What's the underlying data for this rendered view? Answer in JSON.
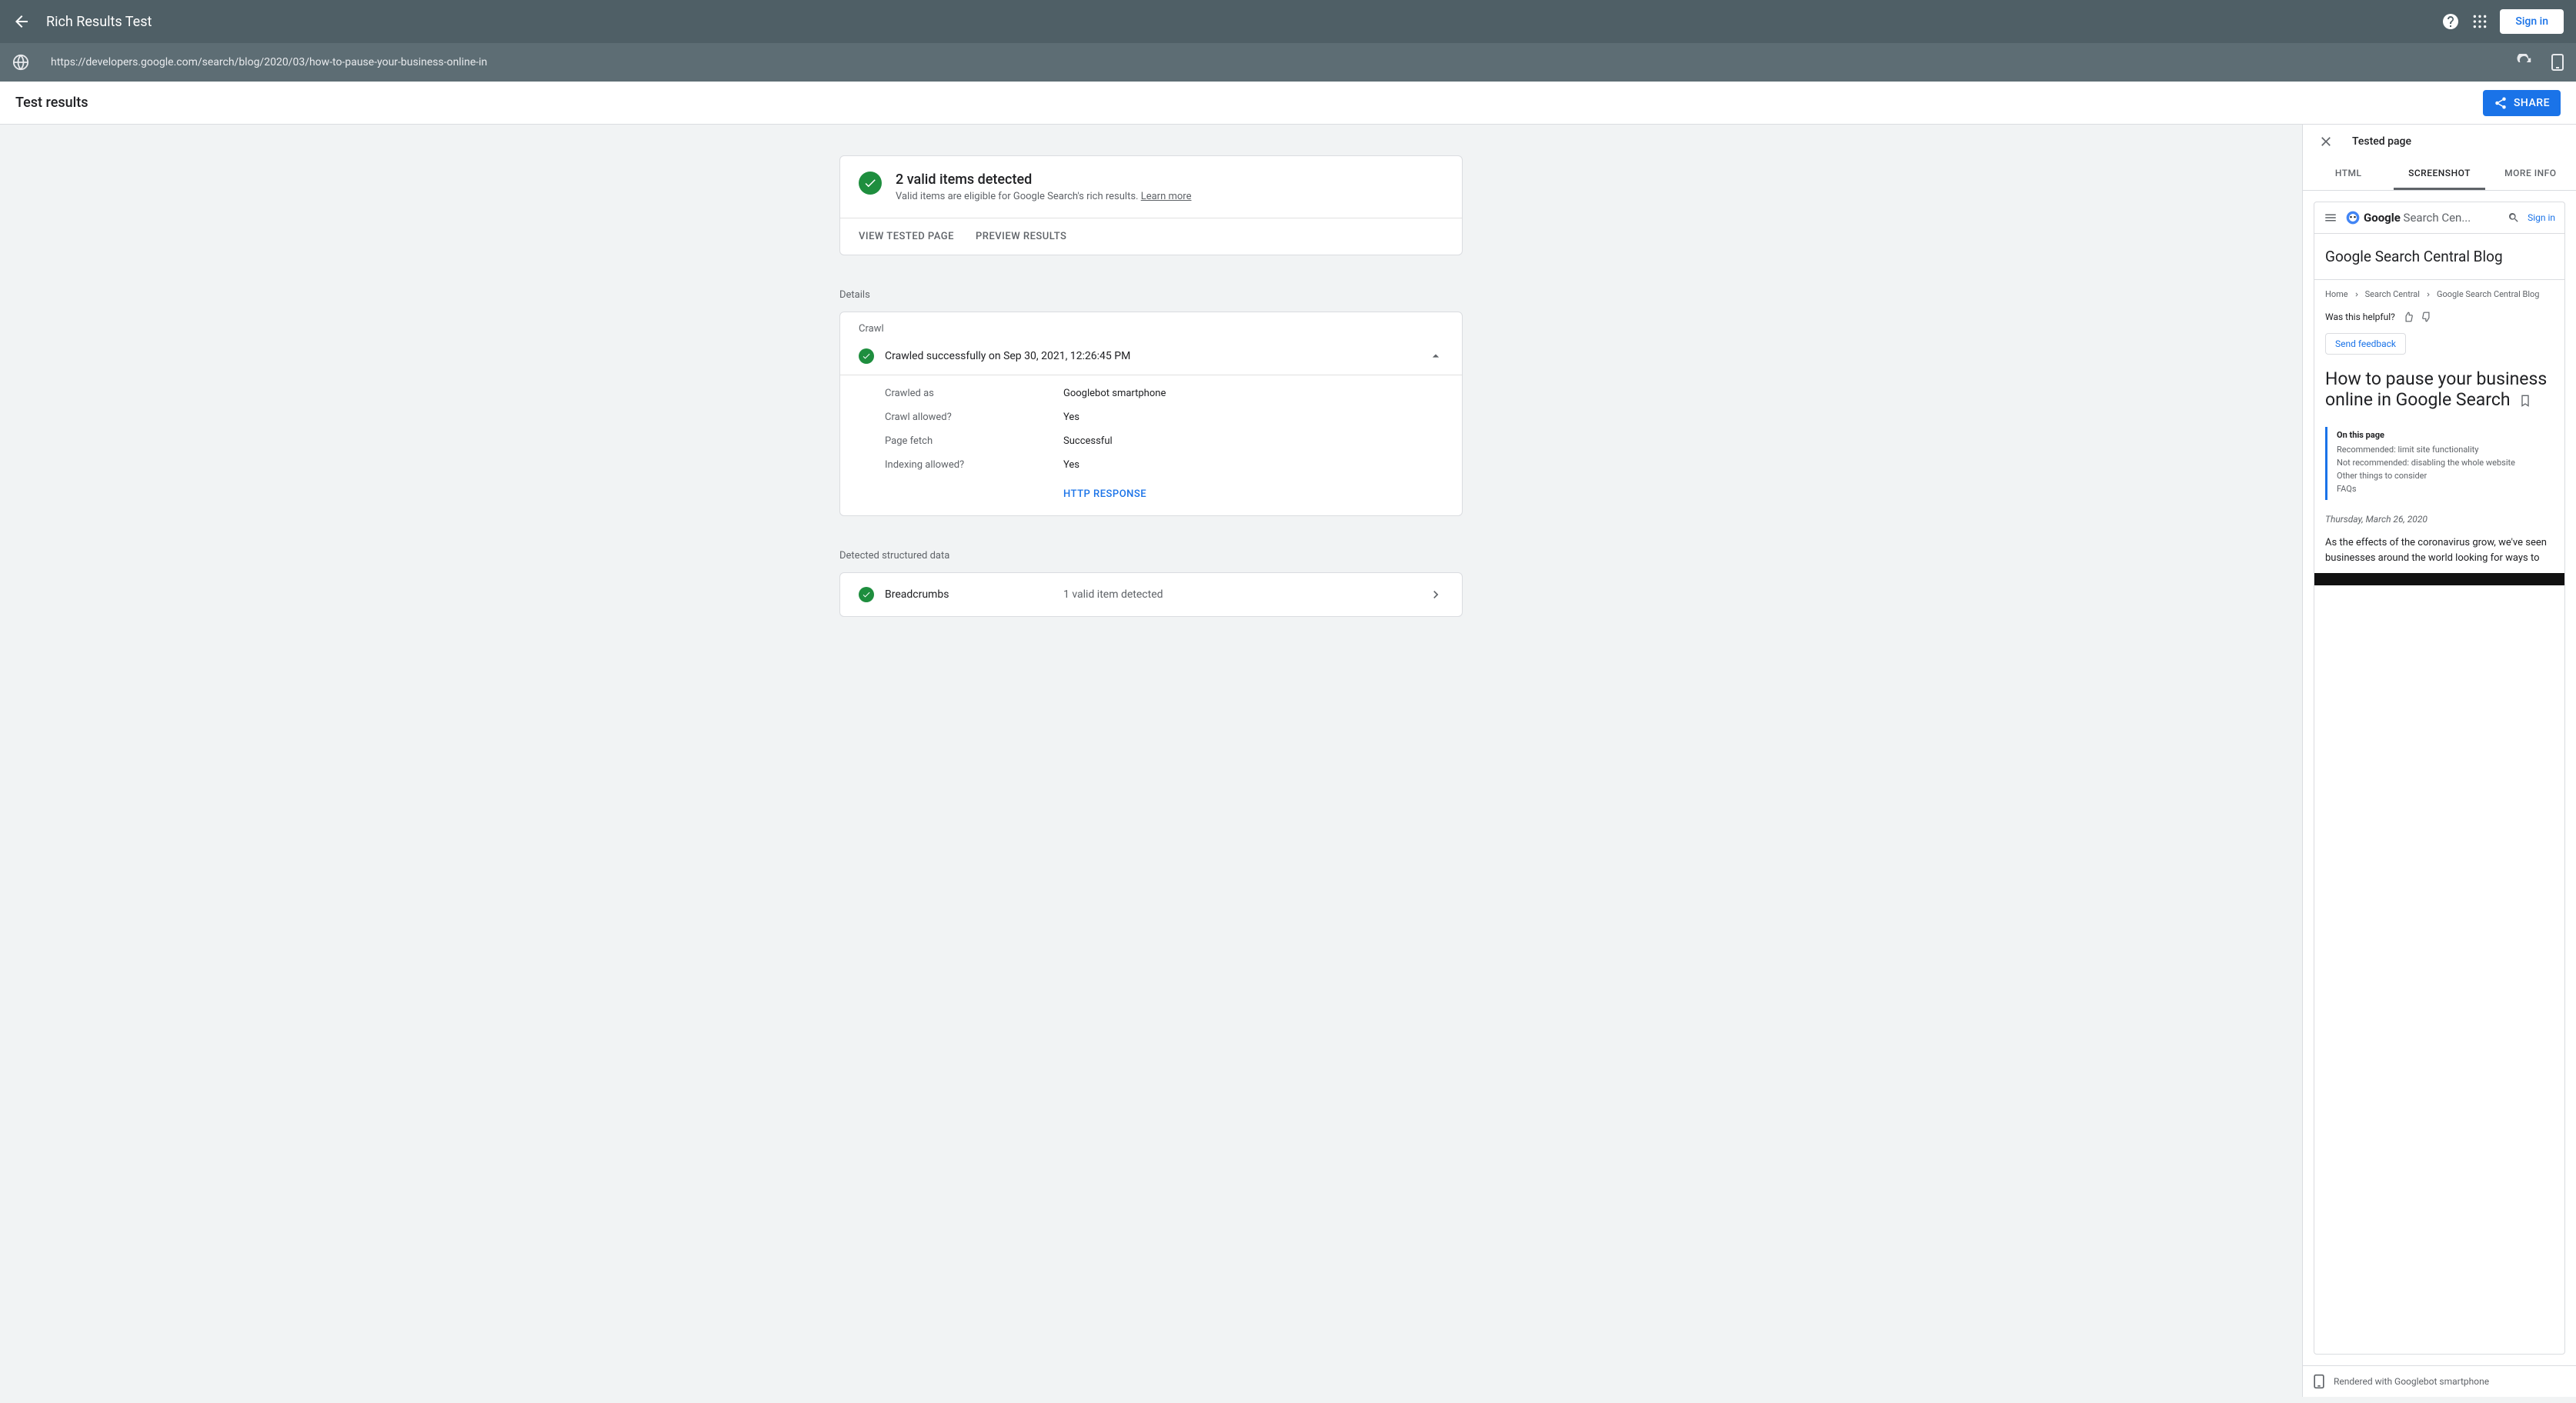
{
  "header": {
    "title": "Rich Results Test",
    "signin": "Sign in"
  },
  "urlbar": {
    "url": "https://developers.google.com/search/blog/2020/03/how-to-pause-your-business-online-in"
  },
  "resultsbar": {
    "title": "Test results",
    "share": "SHARE"
  },
  "summary": {
    "heading": "2 valid items detected",
    "subtitle": "Valid items are eligible for Google Search's rich results. ",
    "learn_more": "Learn more",
    "view_tested_page": "VIEW TESTED PAGE",
    "preview_results": "PREVIEW RESULTS"
  },
  "details": {
    "section_label": "Details",
    "crawl_label": "Crawl",
    "status": "Crawled successfully on Sep 30, 2021, 12:26:45 PM",
    "rows": [
      {
        "label": "Crawled as",
        "value": "Googlebot smartphone"
      },
      {
        "label": "Crawl allowed?",
        "value": "Yes"
      },
      {
        "label": "Page fetch",
        "value": "Successful"
      },
      {
        "label": "Indexing allowed?",
        "value": "Yes"
      }
    ],
    "http_response": "HTTP RESPONSE"
  },
  "structured": {
    "section_label": "Detected structured data",
    "items": [
      {
        "name": "Breadcrumbs",
        "count": "1 valid item detected"
      }
    ]
  },
  "panel": {
    "title": "Tested page",
    "tabs": {
      "html": "HTML",
      "screenshot": "SCREENSHOT",
      "more_info": "MORE INFO"
    },
    "footer": "Rendered with Googlebot smartphone"
  },
  "screenshot": {
    "topnav_brand": "Google",
    "topnav_brand2": "Search Cen...",
    "topnav_signin": "Sign in",
    "blog_title": "Google Search Central Blog",
    "breadcrumbs": [
      "Home",
      "Search Central",
      "Google Search Central Blog"
    ],
    "helpful": "Was this helpful?",
    "send_feedback": "Send feedback",
    "article_title": "How to pause your business online in Google Search",
    "toc_heading": "On this page",
    "toc": [
      "Recommended: limit site functionality",
      "Not recommended: disabling the whole website",
      "Other things to consider",
      "FAQs"
    ],
    "date": "Thursday, March 26, 2020",
    "body_start": "As the effects of the coronavirus grow, we've seen businesses around the world looking for ways to"
  }
}
